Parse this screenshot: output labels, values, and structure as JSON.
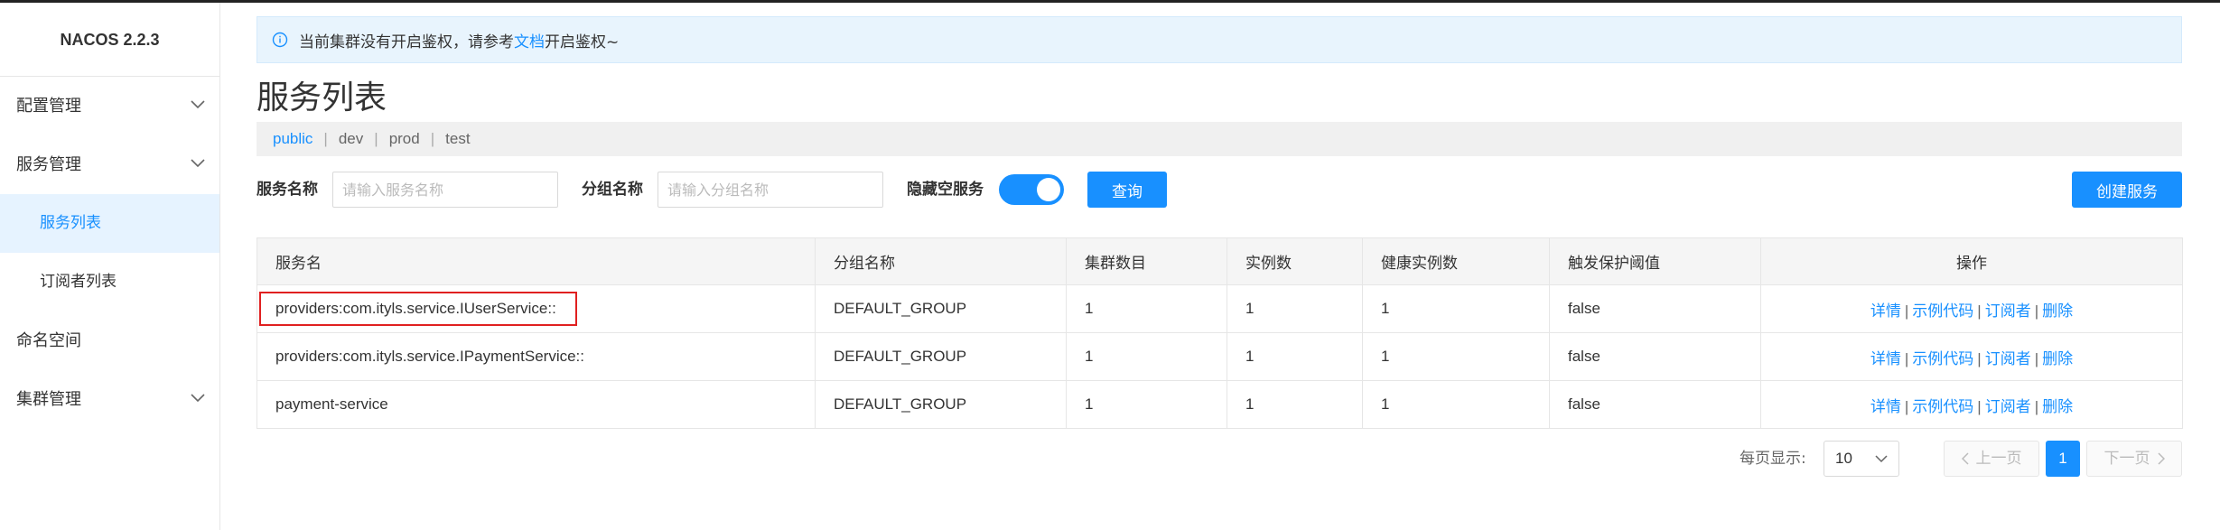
{
  "app": {
    "logo": "NACOS 2.2.3"
  },
  "sidebar": {
    "items": [
      {
        "label": "配置管理",
        "expandable": true
      },
      {
        "label": "服务管理",
        "expandable": true
      },
      {
        "label": "服务列表",
        "sub": true,
        "active": true
      },
      {
        "label": "订阅者列表",
        "sub": true
      },
      {
        "label": "命名空间",
        "expandable": false
      },
      {
        "label": "集群管理",
        "expandable": true
      }
    ]
  },
  "notice": {
    "prefix": "当前集群没有开启鉴权，请参考",
    "link": "文档",
    "suffix": "开启鉴权~"
  },
  "page_title": "服务列表",
  "namespaces": [
    "public",
    "dev",
    "prod",
    "test"
  ],
  "filter": {
    "service_name_label": "服务名称",
    "service_name_placeholder": "请输入服务名称",
    "group_name_label": "分组名称",
    "group_name_placeholder": "请输入分组名称",
    "hide_empty_label": "隐藏空服务",
    "hide_empty_on": true,
    "query_button": "查询",
    "create_button": "创建服务"
  },
  "table": {
    "headers": [
      "服务名",
      "分组名称",
      "集群数目",
      "实例数",
      "健康实例数",
      "触发保护阈值",
      "操作"
    ],
    "rows": [
      {
        "name": "providers:com.ityls.service.IUserService::",
        "group": "DEFAULT_GROUP",
        "clusters": "1",
        "instances": "1",
        "healthy": "1",
        "protect": "false"
      },
      {
        "name": "providers:com.ityls.service.IPaymentService::",
        "group": "DEFAULT_GROUP",
        "clusters": "1",
        "instances": "1",
        "healthy": "1",
        "protect": "false"
      },
      {
        "name": "payment-service",
        "group": "DEFAULT_GROUP",
        "clusters": "1",
        "instances": "1",
        "healthy": "1",
        "protect": "false"
      }
    ],
    "ops": {
      "detail": "详情",
      "sample": "示例代码",
      "subscriber": "订阅者",
      "delete": "删除",
      "separator": "|"
    }
  },
  "pagination": {
    "page_size_label": "每页显示:",
    "page_size": "10",
    "prev": "上一页",
    "next": "下一页",
    "current_page": "1"
  },
  "colors": {
    "accent": "#1890ff",
    "highlight": "#e02020"
  }
}
